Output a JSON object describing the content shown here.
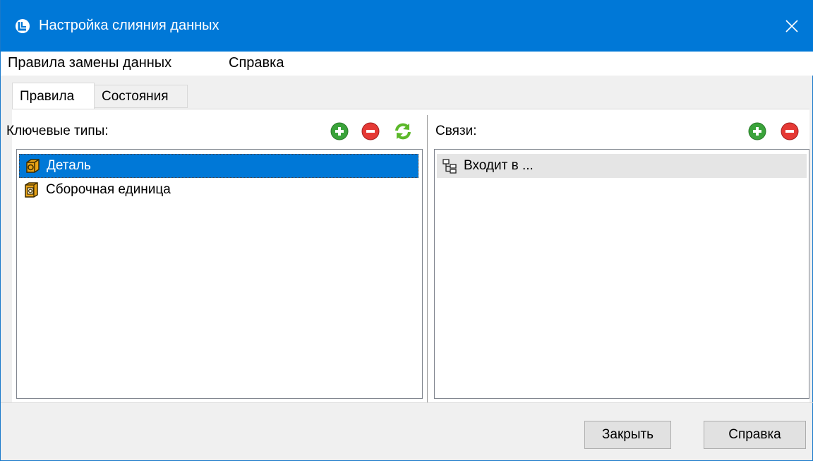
{
  "window": {
    "title": "Настройка слияния данных"
  },
  "menu": {
    "items": [
      "Правила замены данных",
      "Справка"
    ]
  },
  "tabs": [
    {
      "label": "Правила",
      "active": true
    },
    {
      "label": "Состояния",
      "active": false
    }
  ],
  "left_pane": {
    "label": "Ключевые типы:",
    "tools": [
      "add-icon",
      "remove-icon",
      "refresh-icon"
    ],
    "items": [
      {
        "label": "Деталь",
        "icon": "part-icon",
        "selected": true
      },
      {
        "label": "Сборочная единица",
        "icon": "assembly-icon",
        "selected": false
      }
    ]
  },
  "right_pane": {
    "label": "Связи:",
    "tools": [
      "add-icon",
      "remove-icon"
    ],
    "items": [
      {
        "label": "Входит в ...",
        "icon": "tree-link-icon"
      }
    ]
  },
  "buttons": {
    "close": "Закрыть",
    "help": "Справка"
  },
  "colors": {
    "titlebar": "#0078d7",
    "selection": "#0078d7",
    "add": "#3aa33a",
    "remove": "#e53935"
  }
}
